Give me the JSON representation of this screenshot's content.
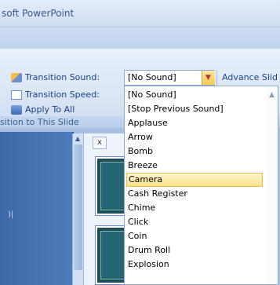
{
  "window": {
    "title": "soft PowerPoint"
  },
  "ribbon": {
    "transition_sound_label": "Transition Sound:",
    "transition_speed_label": "Transition Speed:",
    "apply_to_all_label": "Apply To All",
    "group_label": "sition to This Slide",
    "sound_combo_value": "[No Sound]",
    "advance_label": "Advance Slid"
  },
  "sound_dropdown": {
    "items": [
      "[No Sound]",
      "[Stop Previous Sound]",
      "Applause",
      "Arrow",
      "Bomb",
      "Breeze",
      "Camera",
      "Cash Register",
      "Chime",
      "Click",
      "Coin",
      "Drum Roll",
      "Explosion"
    ],
    "selected": "Camera"
  },
  "pane": {
    "close_label": "x"
  },
  "left_panel": {
    "mark": ")|"
  },
  "icons": {
    "sound": "transition-sound-icon",
    "speed": "transition-speed-icon",
    "apply": "apply-to-all-icon"
  }
}
